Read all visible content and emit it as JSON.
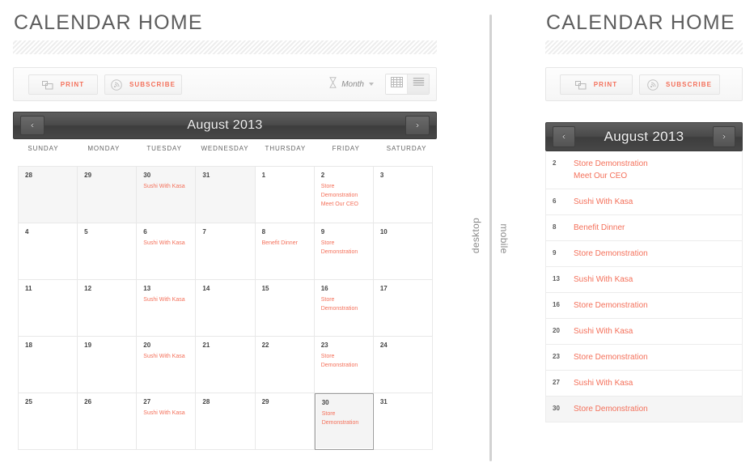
{
  "desktop": {
    "title": "CALENDAR HOME",
    "toolbar": {
      "print_label": "PRINT",
      "subscribe_label": "SUBSCRIBE",
      "print_icon": "printer-icon",
      "subscribe_icon": "subscribe-circle-icon",
      "period_icon": "hourglass-icon",
      "period_value": "Month",
      "view_grid_icon": "grid-view-icon",
      "view_list_icon": "list-view-icon"
    },
    "nav": {
      "prev_label": "‹",
      "next_label": "›",
      "month_title": "August 2013"
    },
    "weekdays": [
      "SUNDAY",
      "MONDAY",
      "TUESDAY",
      "WEDNESDAY",
      "THURSDAY",
      "FRIDAY",
      "SATURDAY"
    ],
    "cells": [
      {
        "day": "28",
        "other": true,
        "selected": false,
        "events": []
      },
      {
        "day": "29",
        "other": true,
        "selected": false,
        "events": []
      },
      {
        "day": "30",
        "other": true,
        "selected": false,
        "events": [
          "Sushi With Kasa"
        ]
      },
      {
        "day": "31",
        "other": true,
        "selected": false,
        "events": []
      },
      {
        "day": "1",
        "other": false,
        "selected": false,
        "events": []
      },
      {
        "day": "2",
        "other": false,
        "selected": false,
        "events": [
          "Store Demonstration",
          "Meet Our CEO"
        ]
      },
      {
        "day": "3",
        "other": false,
        "selected": false,
        "events": []
      },
      {
        "day": "4",
        "other": false,
        "selected": false,
        "events": []
      },
      {
        "day": "5",
        "other": false,
        "selected": false,
        "events": []
      },
      {
        "day": "6",
        "other": false,
        "selected": false,
        "events": [
          "Sushi With Kasa"
        ]
      },
      {
        "day": "7",
        "other": false,
        "selected": false,
        "events": []
      },
      {
        "day": "8",
        "other": false,
        "selected": false,
        "events": [
          "Benefit Dinner"
        ]
      },
      {
        "day": "9",
        "other": false,
        "selected": false,
        "events": [
          "Store Demonstration"
        ]
      },
      {
        "day": "10",
        "other": false,
        "selected": false,
        "events": []
      },
      {
        "day": "11",
        "other": false,
        "selected": false,
        "events": []
      },
      {
        "day": "12",
        "other": false,
        "selected": false,
        "events": []
      },
      {
        "day": "13",
        "other": false,
        "selected": false,
        "events": [
          "Sushi With Kasa"
        ]
      },
      {
        "day": "14",
        "other": false,
        "selected": false,
        "events": []
      },
      {
        "day": "15",
        "other": false,
        "selected": false,
        "events": []
      },
      {
        "day": "16",
        "other": false,
        "selected": false,
        "events": [
          "Store Demonstration"
        ]
      },
      {
        "day": "17",
        "other": false,
        "selected": false,
        "events": []
      },
      {
        "day": "18",
        "other": false,
        "selected": false,
        "events": []
      },
      {
        "day": "19",
        "other": false,
        "selected": false,
        "events": []
      },
      {
        "day": "20",
        "other": false,
        "selected": false,
        "events": [
          "Sushi With Kasa"
        ]
      },
      {
        "day": "21",
        "other": false,
        "selected": false,
        "events": []
      },
      {
        "day": "22",
        "other": false,
        "selected": false,
        "events": []
      },
      {
        "day": "23",
        "other": false,
        "selected": false,
        "events": [
          "Store Demonstration"
        ]
      },
      {
        "day": "24",
        "other": false,
        "selected": false,
        "events": []
      },
      {
        "day": "25",
        "other": false,
        "selected": false,
        "events": []
      },
      {
        "day": "26",
        "other": false,
        "selected": false,
        "events": []
      },
      {
        "day": "27",
        "other": false,
        "selected": false,
        "events": [
          "Sushi With Kasa"
        ]
      },
      {
        "day": "28",
        "other": false,
        "selected": false,
        "events": []
      },
      {
        "day": "29",
        "other": false,
        "selected": false,
        "events": []
      },
      {
        "day": "30",
        "other": false,
        "selected": true,
        "events": [
          "Store Demonstration"
        ]
      },
      {
        "day": "31",
        "other": false,
        "selected": false,
        "events": []
      }
    ]
  },
  "mobile": {
    "title": "CALENDAR HOME",
    "toolbar": {
      "print_label": "PRINT",
      "subscribe_label": "SUBSCRIBE",
      "print_icon": "printer-icon",
      "subscribe_icon": "subscribe-circle-icon"
    },
    "nav": {
      "prev_label": "‹",
      "next_label": "›",
      "month_title": "August 2013"
    },
    "rows": [
      {
        "day": "2",
        "selected": false,
        "events": [
          "Store Demonstration",
          "Meet Our CEO"
        ]
      },
      {
        "day": "6",
        "selected": false,
        "events": [
          "Sushi With Kasa"
        ]
      },
      {
        "day": "8",
        "selected": false,
        "events": [
          "Benefit Dinner"
        ]
      },
      {
        "day": "9",
        "selected": false,
        "events": [
          "Store Demonstration"
        ]
      },
      {
        "day": "13",
        "selected": false,
        "events": [
          "Sushi With Kasa"
        ]
      },
      {
        "day": "16",
        "selected": false,
        "events": [
          "Store Demonstration"
        ]
      },
      {
        "day": "20",
        "selected": false,
        "events": [
          "Sushi With Kasa"
        ]
      },
      {
        "day": "23",
        "selected": false,
        "events": [
          "Store Demonstration"
        ]
      },
      {
        "day": "27",
        "selected": false,
        "events": [
          "Sushi With Kasa"
        ]
      },
      {
        "day": "30",
        "selected": true,
        "events": [
          "Store Demonstration"
        ]
      }
    ]
  },
  "divider": {
    "left_label": "desktop",
    "right_label": "mobile"
  },
  "colors": {
    "accent": "#f4705a",
    "nav_bar_dark": "#4a4a4a",
    "text_gray": "#5d5d5d",
    "border": "#e8e8e8"
  }
}
